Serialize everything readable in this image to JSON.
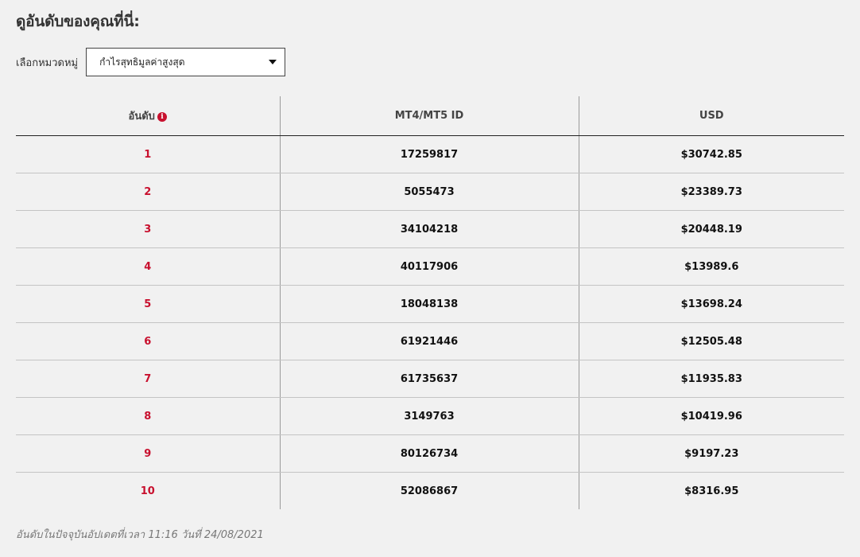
{
  "page": {
    "heading": "ดูอันดับของคุณที่นี่:"
  },
  "filter": {
    "label": "เลือกหมวดหมู่",
    "selected": "กำไรสุทธิมูลค่าสูงสุด"
  },
  "table": {
    "columns": [
      "อันดับ",
      "MT4/MT5 ID",
      "USD"
    ],
    "rows": [
      {
        "rank": "1",
        "id": "17259817",
        "usd": "$30742.85"
      },
      {
        "rank": "2",
        "id": "5055473",
        "usd": "$23389.73"
      },
      {
        "rank": "3",
        "id": "34104218",
        "usd": "$20448.19"
      },
      {
        "rank": "4",
        "id": "40117906",
        "usd": "$13989.6"
      },
      {
        "rank": "5",
        "id": "18048138",
        "usd": "$13698.24"
      },
      {
        "rank": "6",
        "id": "61921446",
        "usd": "$12505.48"
      },
      {
        "rank": "7",
        "id": "61735637",
        "usd": "$11935.83"
      },
      {
        "rank": "8",
        "id": "3149763",
        "usd": "$10419.96"
      },
      {
        "rank": "9",
        "id": "80126734",
        "usd": "$9197.23"
      },
      {
        "rank": "10",
        "id": "52086867",
        "usd": "$8316.95"
      }
    ]
  },
  "footnote": "อันดับในปัจจุบันอัปเดตที่เวลา 11:16 วันที่ 24/08/2021",
  "colors": {
    "accent": "#c8102e",
    "background": "#f1f1f1"
  },
  "icons": {
    "info": "info-icon",
    "dropdown": "caret-down-icon"
  }
}
